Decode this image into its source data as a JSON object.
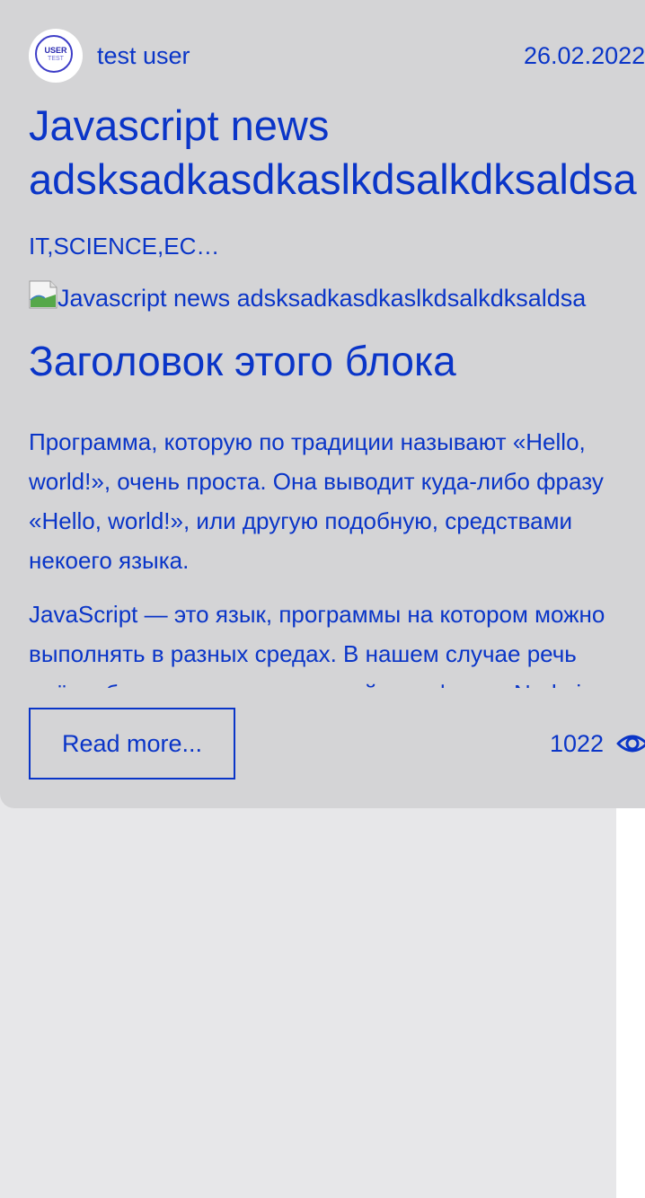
{
  "post": {
    "author": "test user",
    "avatar_text_1": "USER",
    "avatar_text_2": "TEST",
    "date": "26.02.2022",
    "title_line_1": "Javascript news",
    "title_line_2": "adsksadkasdkaslkdsalkdksaldsa",
    "tags": "IT,SCIENCE,EC…",
    "image_alt": "Javascript news adsksadkasdkaslkdsalkdksaldsa",
    "block_heading": "Заголовок этого блока",
    "paragraph_1_lines": [
      "Программа, которую по традиции называют «Hello,",
      "world!», очень проста. Она выводит куда-либо фразу",
      "«Hello, world!», или другую подобную, средствами",
      "некоего языка."
    ],
    "paragraph_2_lines": [
      "JavaScript — это язык, программы на котором можно",
      "выполнять в разных средах. В нашем случае речь",
      "идёт о браузерах и о серверной платформе Node.js."
    ],
    "read_more_label": "Read more...",
    "views": "1022"
  },
  "colors": {
    "text": "#0a35c8",
    "card_bg": "#d4d4d6",
    "page_bg": "#e7e7e9"
  },
  "icons": {
    "views": "eye-icon",
    "broken_image": "broken-image-icon"
  }
}
